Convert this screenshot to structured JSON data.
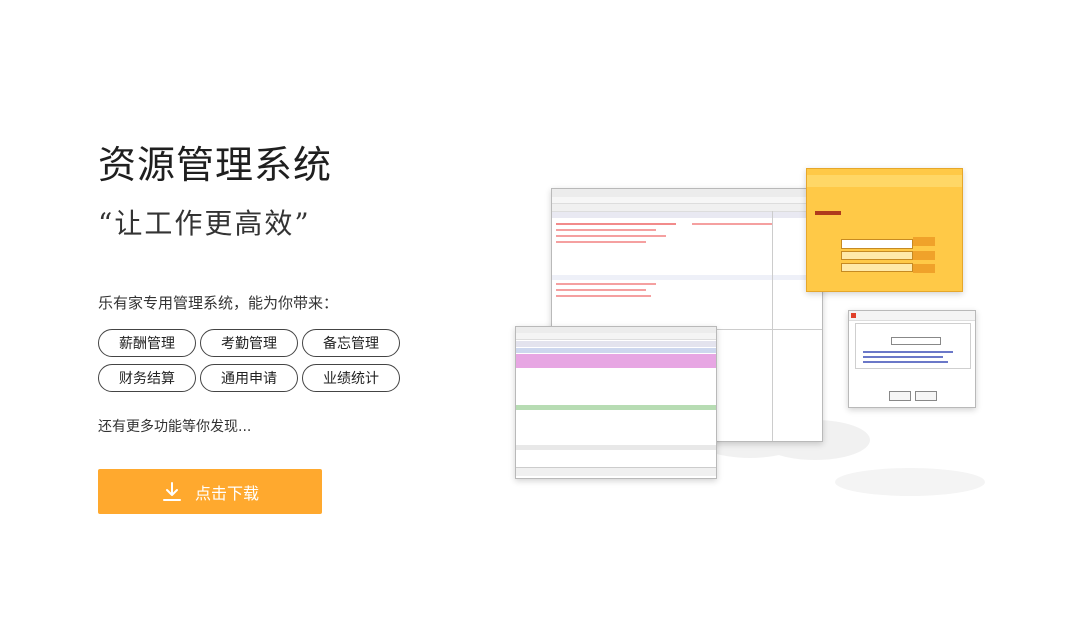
{
  "title": "资源管理系统",
  "slogan": "“让工作更高效”",
  "intro": "乐有家专用管理系统，能为你带来：",
  "features": [
    "薪酬管理",
    "考勤管理",
    "备忘管理",
    "财务结算",
    "通用申请",
    "业绩统计"
  ],
  "more": "还有更多功能等你发现...",
  "download_label": "点击下载",
  "colors": {
    "accent": "#ffa92e",
    "login_panel": "#ffc947",
    "pink_rows": "#e7a6e3",
    "green_bar": "#b7dcb3"
  },
  "icons": {
    "download": "download-icon"
  }
}
